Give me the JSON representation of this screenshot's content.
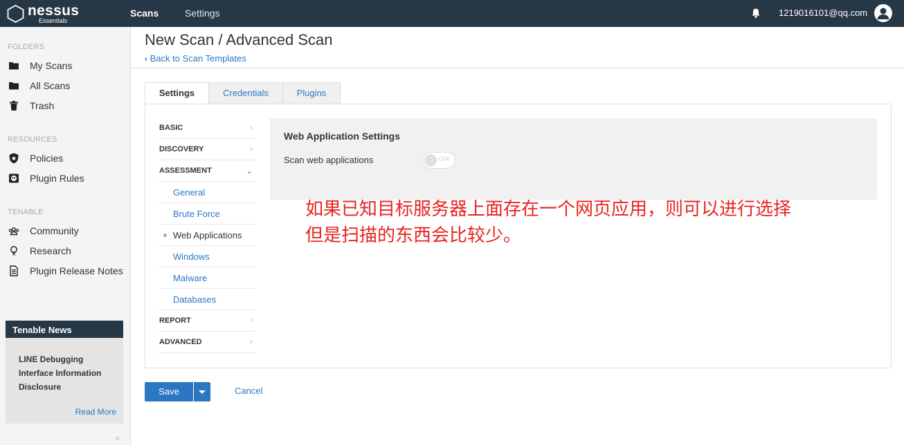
{
  "app": {
    "name": "nessus",
    "edition": "Essentials"
  },
  "topnav": {
    "scans": "Scans",
    "settings": "Settings",
    "user_email": "1219016101@qq.com"
  },
  "sidebar": {
    "folders_head": "FOLDERS",
    "folders": [
      {
        "label": "My Scans",
        "icon": "folder-icon"
      },
      {
        "label": "All Scans",
        "icon": "folder-icon"
      },
      {
        "label": "Trash",
        "icon": "trash-icon"
      }
    ],
    "resources_head": "RESOURCES",
    "resources": [
      {
        "label": "Policies",
        "icon": "shield-icon"
      },
      {
        "label": "Plugin Rules",
        "icon": "plugin-icon"
      }
    ],
    "tenable_head": "TENABLE",
    "tenable": [
      {
        "label": "Community",
        "icon": "community-icon"
      },
      {
        "label": "Research",
        "icon": "lightbulb-icon"
      },
      {
        "label": "Plugin Release Notes",
        "icon": "document-icon"
      }
    ],
    "news": {
      "title": "Tenable News",
      "headline": "LINE Debugging Interface Information Disclosure",
      "read_more": "Read More"
    },
    "collapse": "«"
  },
  "header": {
    "title": "New Scan / Advanced Scan",
    "back": "Back to Scan Templates"
  },
  "tabs": [
    {
      "label": "Settings",
      "active": true
    },
    {
      "label": "Credentials",
      "active": false
    },
    {
      "label": "Plugins",
      "active": false
    }
  ],
  "settings_nav": {
    "basic": "BASIC",
    "discovery": "DISCOVERY",
    "assessment": "ASSESSMENT",
    "assessment_items": [
      "General",
      "Brute Force",
      "Web Applications",
      "Windows",
      "Malware",
      "Databases"
    ],
    "report": "REPORT",
    "advanced": "ADVANCED"
  },
  "web_app_settings": {
    "title": "Web Application Settings",
    "scan_label": "Scan web applications",
    "toggle_text": "OFF",
    "enabled": false
  },
  "annotation": {
    "line1": "如果已知目标服务器上面存在一个网页应用，则可以进行选择",
    "line2": "但是扫描的东西会比较少。"
  },
  "actions": {
    "save": "Save",
    "cancel": "Cancel"
  },
  "colors": {
    "topbar": "#263746",
    "link": "#2b77c2",
    "annotation": "#e8231f"
  }
}
